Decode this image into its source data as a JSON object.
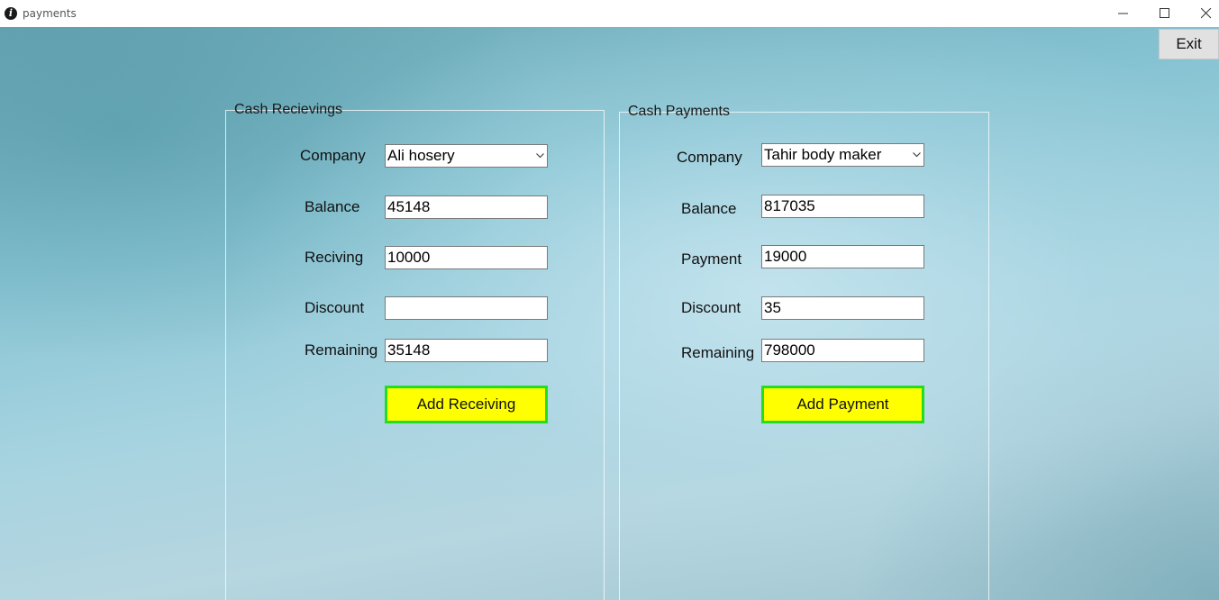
{
  "window": {
    "title": "payments",
    "icon": "info-icon"
  },
  "toolbar": {
    "exit_label": "Exit"
  },
  "receivings": {
    "title": "Cash Recievings",
    "company_label": "Company",
    "company_value": "Ali hosery",
    "balance_label": "Balance",
    "balance_value": "45148",
    "receiving_label": "Reciving",
    "receiving_value": "10000",
    "discount_label": "Discount",
    "discount_value": "",
    "remaining_label": "Remaining",
    "remaining_value": "35148",
    "button_label": "Add Receiving"
  },
  "payments": {
    "title": "Cash Payments",
    "company_label": "Company",
    "company_value": "Tahir body maker",
    "balance_label": "Balance",
    "balance_value": "817035",
    "payment_label": "Payment",
    "payment_value": "19000",
    "discount_label": "Discount",
    "discount_value": "35",
    "remaining_label": "Remaining",
    "remaining_value": "798000",
    "button_label": "Add Payment"
  },
  "colors": {
    "action_button_fill": "#ffff00",
    "action_button_border": "#22dd22"
  }
}
